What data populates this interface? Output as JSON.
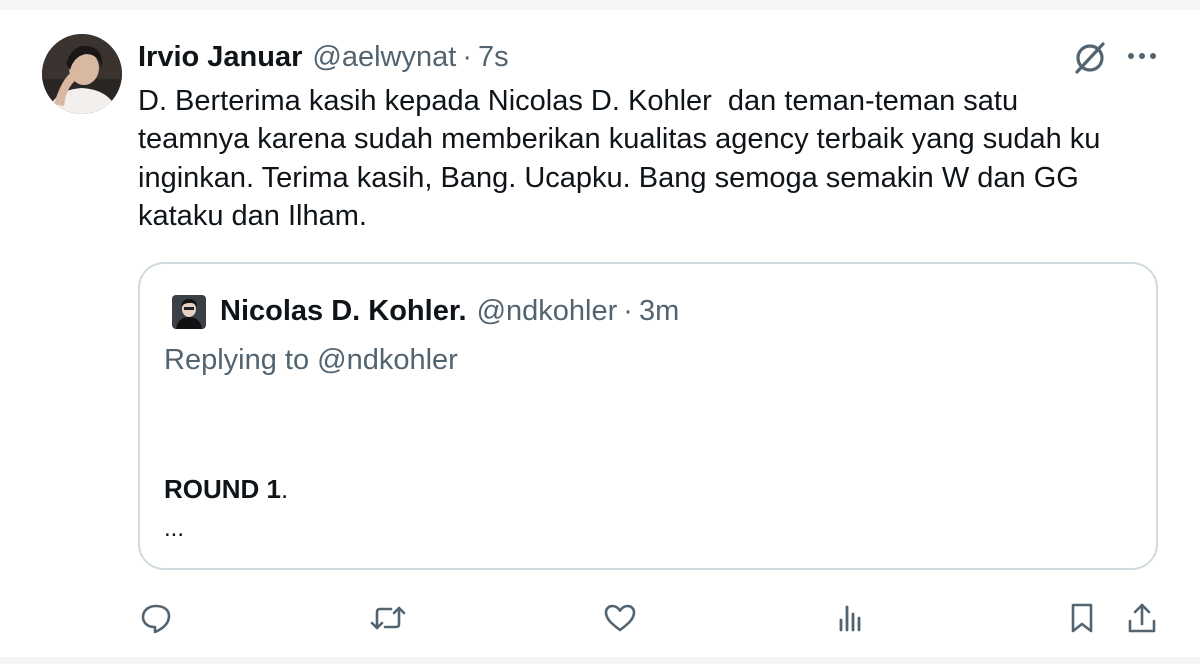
{
  "tweet": {
    "display_name": "Irvio Januar",
    "handle": "@aelwynat",
    "separator": "·",
    "time": "7s",
    "text": "D. Berterima kasih kepada Nicolas D. Kohler  dan teman-teman satu\nteamnya karena sudah memberikan kualitas agency terbaik yang sudah ku\ninginkan. Terima kasih, Bang. Ucapku. Bang semoga semakin W dan GG\nkataku dan Ilham."
  },
  "quote": {
    "display_name": "Nicolas D. Kohler.",
    "handle": "@ndkohler",
    "separator": "·",
    "time": "3m",
    "replying": "Replying to @ndkohler",
    "round_bold": "ROUND 1",
    "round_punct": ".",
    "ellipsis": "..."
  },
  "icons": {
    "header": [
      "grok-icon",
      "more-icon"
    ],
    "actions": [
      "reply-icon",
      "repost-icon",
      "like-icon",
      "views-icon",
      "bookmark-icon",
      "share-icon"
    ]
  },
  "colors": {
    "text_primary": "#0f1419",
    "text_secondary": "#536471",
    "border": "#cfd9de",
    "icon": "#536471"
  }
}
